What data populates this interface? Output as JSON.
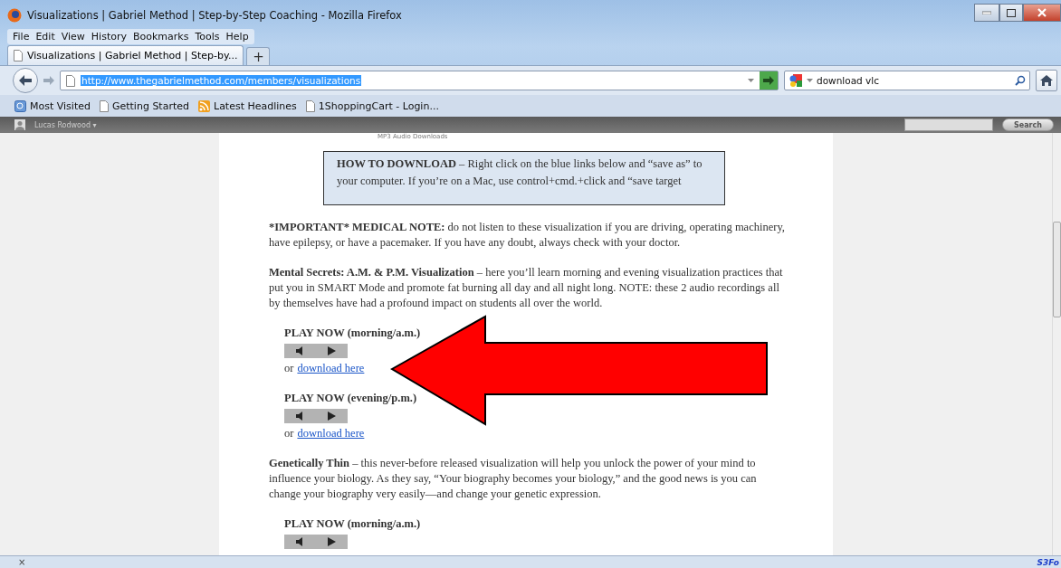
{
  "window": {
    "title": "Visualizations | Gabriel Method | Step-by-Step Coaching - Mozilla Firefox"
  },
  "menu": [
    "File",
    "Edit",
    "View",
    "History",
    "Bookmarks",
    "Tools",
    "Help"
  ],
  "tabs": [
    {
      "label": "Visualizations | Gabriel Method | Step-by...",
      "selected": true
    }
  ],
  "new_tab": "+",
  "url": "http://www.thegabrielmethod.com/members/visualizations",
  "search": {
    "value": "download vlc"
  },
  "bookmarks": [
    {
      "label": "Most Visited",
      "kind": "smart"
    },
    {
      "label": "Getting Started",
      "kind": "page"
    },
    {
      "label": "Latest Headlines",
      "kind": "feed"
    },
    {
      "label": "1ShoppingCart - Login...",
      "kind": "page"
    }
  ],
  "user_bar": {
    "user": "Lucas Rodwood ▾",
    "search_button": "Search"
  },
  "page": {
    "header": "MP3 Audio Downloads",
    "notice": {
      "lead": "HOW TO DOWNLOAD",
      "text": " – Right click on the blue links below and “save as” to your computer. If you’re on a Mac, use control+cmd.+click and “save target"
    },
    "blocks": [
      {
        "kind": "paragraph",
        "lead": "*IMPORTANT* MEDICAL NOTE:",
        "text": " do not listen to these visualization if you are driving, operating machinery, have epilepsy, or have a pacemaker. If you have any doubt, always check with your doctor."
      },
      {
        "kind": "paragraph",
        "lead": "Mental Secrets: A.M. & P.M. Visualization",
        "text": " – here you’ll learn morning and evening visualization practices that put you in SMART Mode and promote fat burning all day and all night long. NOTE: these 2 audio recordings all by themselves have had a profound impact on students all over the world."
      },
      {
        "kind": "player",
        "label": "PLAY NOW (morning/a.m.)",
        "prefix": "or",
        "link": "download here"
      },
      {
        "kind": "player",
        "label": "PLAY NOW (evening/p.m.)",
        "prefix": "or",
        "link": "download here"
      },
      {
        "kind": "paragraph",
        "lead": "Genetically Thin",
        "text": " – this never-before released visualization will help you unlock the power of your mind to influence your biology. As they say, “Your biography becomes your biology,” and the good news is you can change your biography very easily—and change your genetic expression."
      },
      {
        "kind": "player",
        "label": "PLAY NOW (morning/a.m.)"
      }
    ]
  },
  "status_bar": {
    "close": "×",
    "addon": "S3Fo"
  }
}
